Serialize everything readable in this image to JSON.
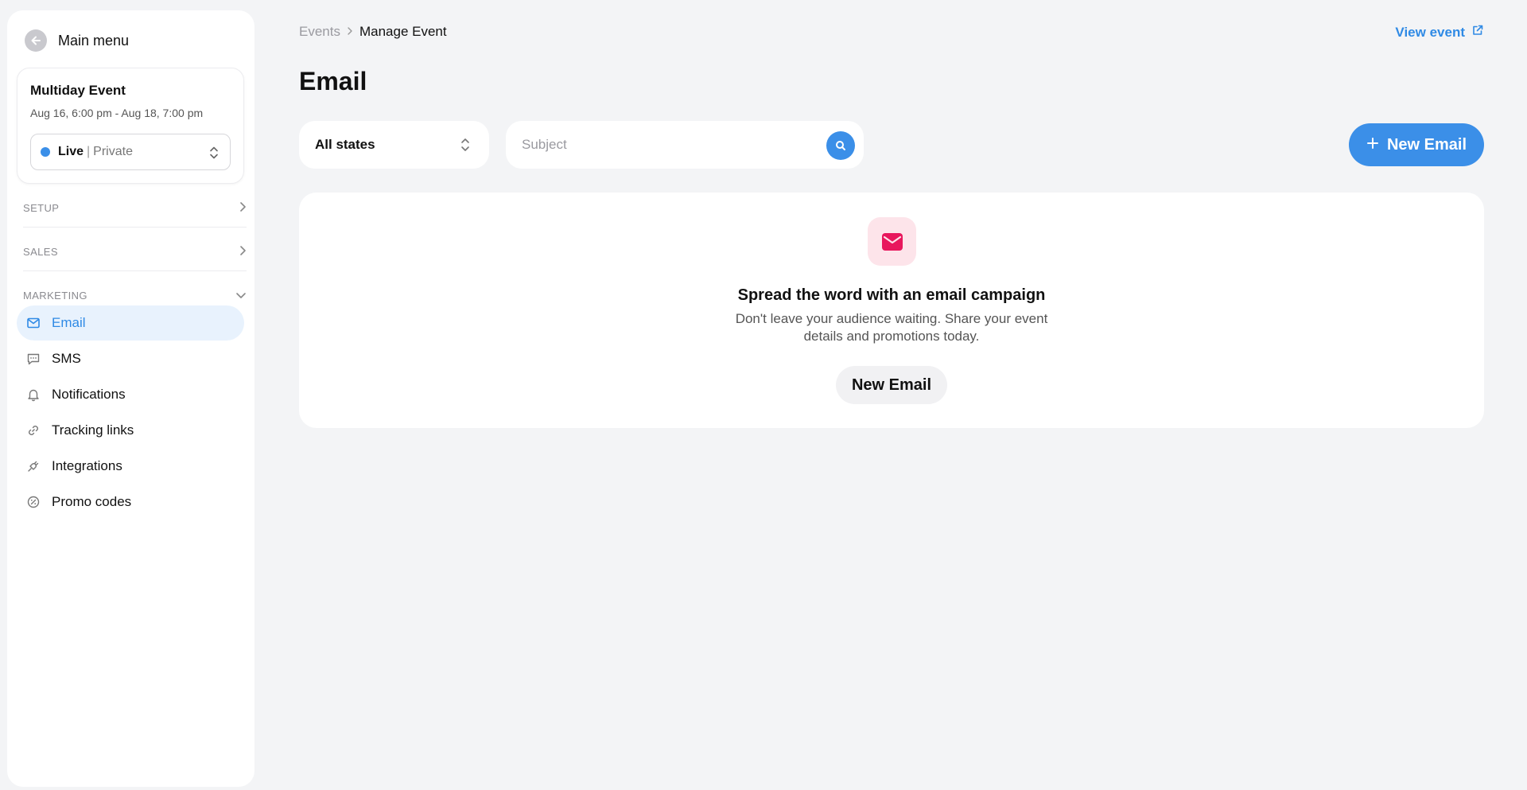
{
  "sidebar": {
    "main_menu_label": "Main menu",
    "event": {
      "title": "Multiday Event",
      "dates": "Aug 16, 6:00 pm - Aug 18, 7:00 pm",
      "status_live": "Live",
      "status_separator": "|",
      "status_visibility": "Private",
      "status_dot_color": "#3b8fe8"
    },
    "sections": {
      "setup": "SETUP",
      "sales": "SALES",
      "marketing": "MARKETING"
    },
    "items": [
      {
        "label": "Email",
        "icon": "mail-icon",
        "active": true
      },
      {
        "label": "SMS",
        "icon": "chat-icon",
        "active": false
      },
      {
        "label": "Notifications",
        "icon": "bell-icon",
        "active": false
      },
      {
        "label": "Tracking links",
        "icon": "link-icon",
        "active": false
      },
      {
        "label": "Integrations",
        "icon": "plug-icon",
        "active": false
      },
      {
        "label": "Promo codes",
        "icon": "discount-badge-icon",
        "active": false
      }
    ]
  },
  "header": {
    "breadcrumb_root": "Events",
    "breadcrumb_current": "Manage Event",
    "view_event_label": "View event",
    "page_title": "Email"
  },
  "filters": {
    "state_selected": "All states",
    "search_placeholder": "Subject",
    "new_email_label": "New Email"
  },
  "empty_state": {
    "title": "Spread the word with an email campaign",
    "description": "Don't leave your audience waiting. Share your event details and promotions today.",
    "button_label": "New Email"
  },
  "colors": {
    "accent": "#3b8fe8",
    "active_bg": "#e8f2fd",
    "mail_badge_bg": "#fde4ea",
    "mail_icon": "#e8175d",
    "page_bg": "#f3f4f6"
  }
}
